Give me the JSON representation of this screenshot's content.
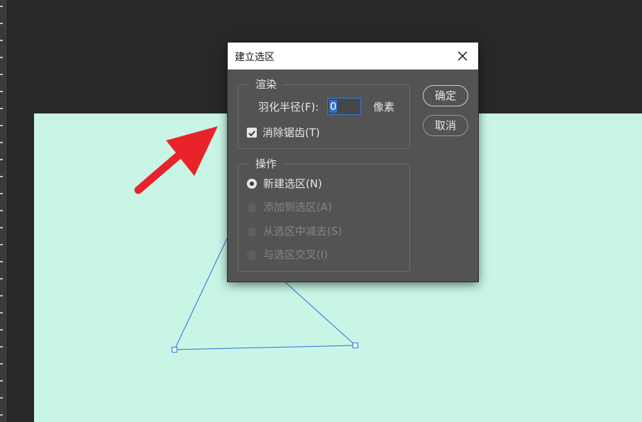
{
  "dialog": {
    "title": "建立选区",
    "render_group": {
      "title": "渲染",
      "feather_label": "羽化半径(F):",
      "feather_value": "0",
      "feather_unit": "像素",
      "antialias_label": "消除锯齿(T)",
      "antialias_checked": true
    },
    "operation_group": {
      "title": "操作",
      "options": [
        {
          "label": "新建选区(N)",
          "selected": true,
          "enabled": true
        },
        {
          "label": "添加到选区(A)",
          "selected": false,
          "enabled": false
        },
        {
          "label": "从选区中减去(S)",
          "selected": false,
          "enabled": false
        },
        {
          "label": "与选区交叉(I)",
          "selected": false,
          "enabled": false
        }
      ]
    },
    "ok_label": "确定",
    "cancel_label": "取消"
  },
  "colors": {
    "canvas": "#c8f5e6",
    "workspace": "#282828",
    "dialog_bg": "#535353",
    "path_stroke": "#2a6fd6",
    "arrow": "#e8232a"
  }
}
